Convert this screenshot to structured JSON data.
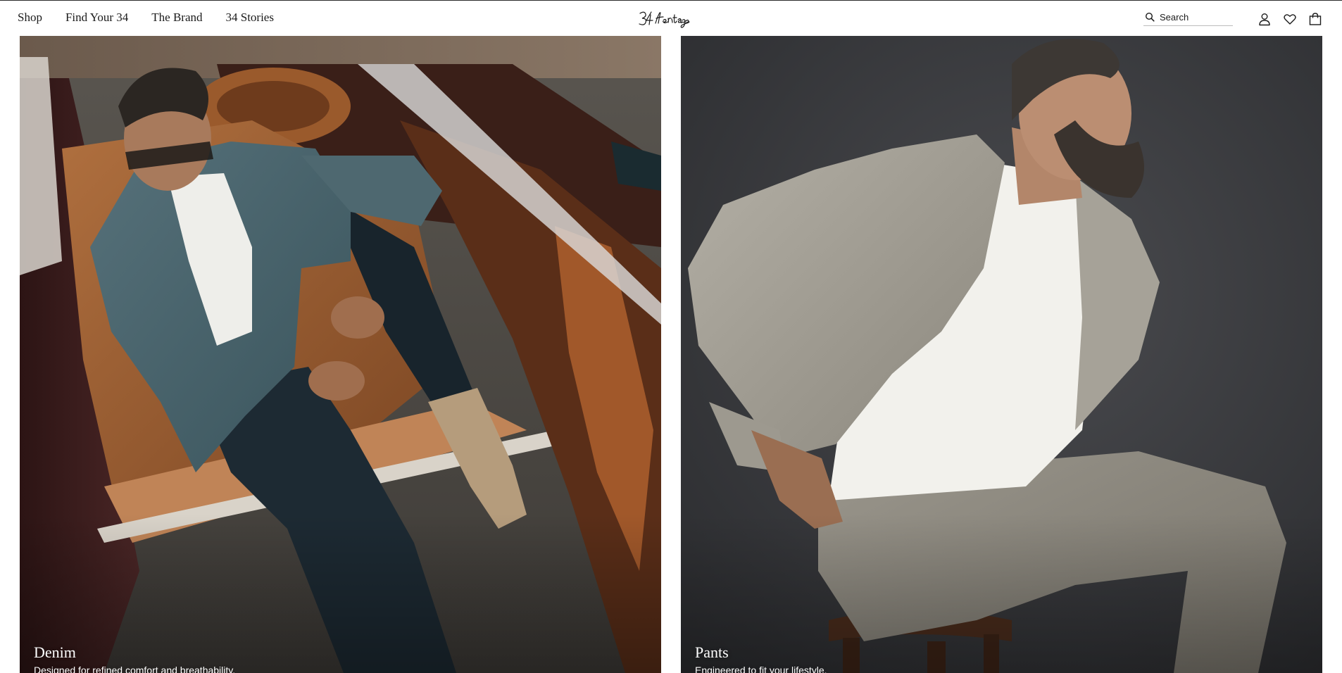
{
  "header": {
    "nav": [
      {
        "label": "Shop"
      },
      {
        "label": "Find Your 34"
      },
      {
        "label": "The Brand"
      },
      {
        "label": "34 Stories"
      }
    ],
    "logo_text": "34 Heritage",
    "search": {
      "placeholder": "Search",
      "icon": "search-icon"
    },
    "icons": [
      "account-icon",
      "heart-icon",
      "bag-icon"
    ]
  },
  "tiles": [
    {
      "title": "Denim",
      "text": "Designed for refined comfort and breathability.",
      "image": "man-in-denim-jacket-stepping-out-of-vintage-car"
    },
    {
      "title": "Pants",
      "text": "Engineered to fit your lifestyle.",
      "image": "man-in-grey-jacket-and-pants-sitting-on-stool"
    }
  ],
  "colors": {
    "header_bg": "#ffffff",
    "text": "#1b1b1b",
    "caption": "#ffffff"
  }
}
